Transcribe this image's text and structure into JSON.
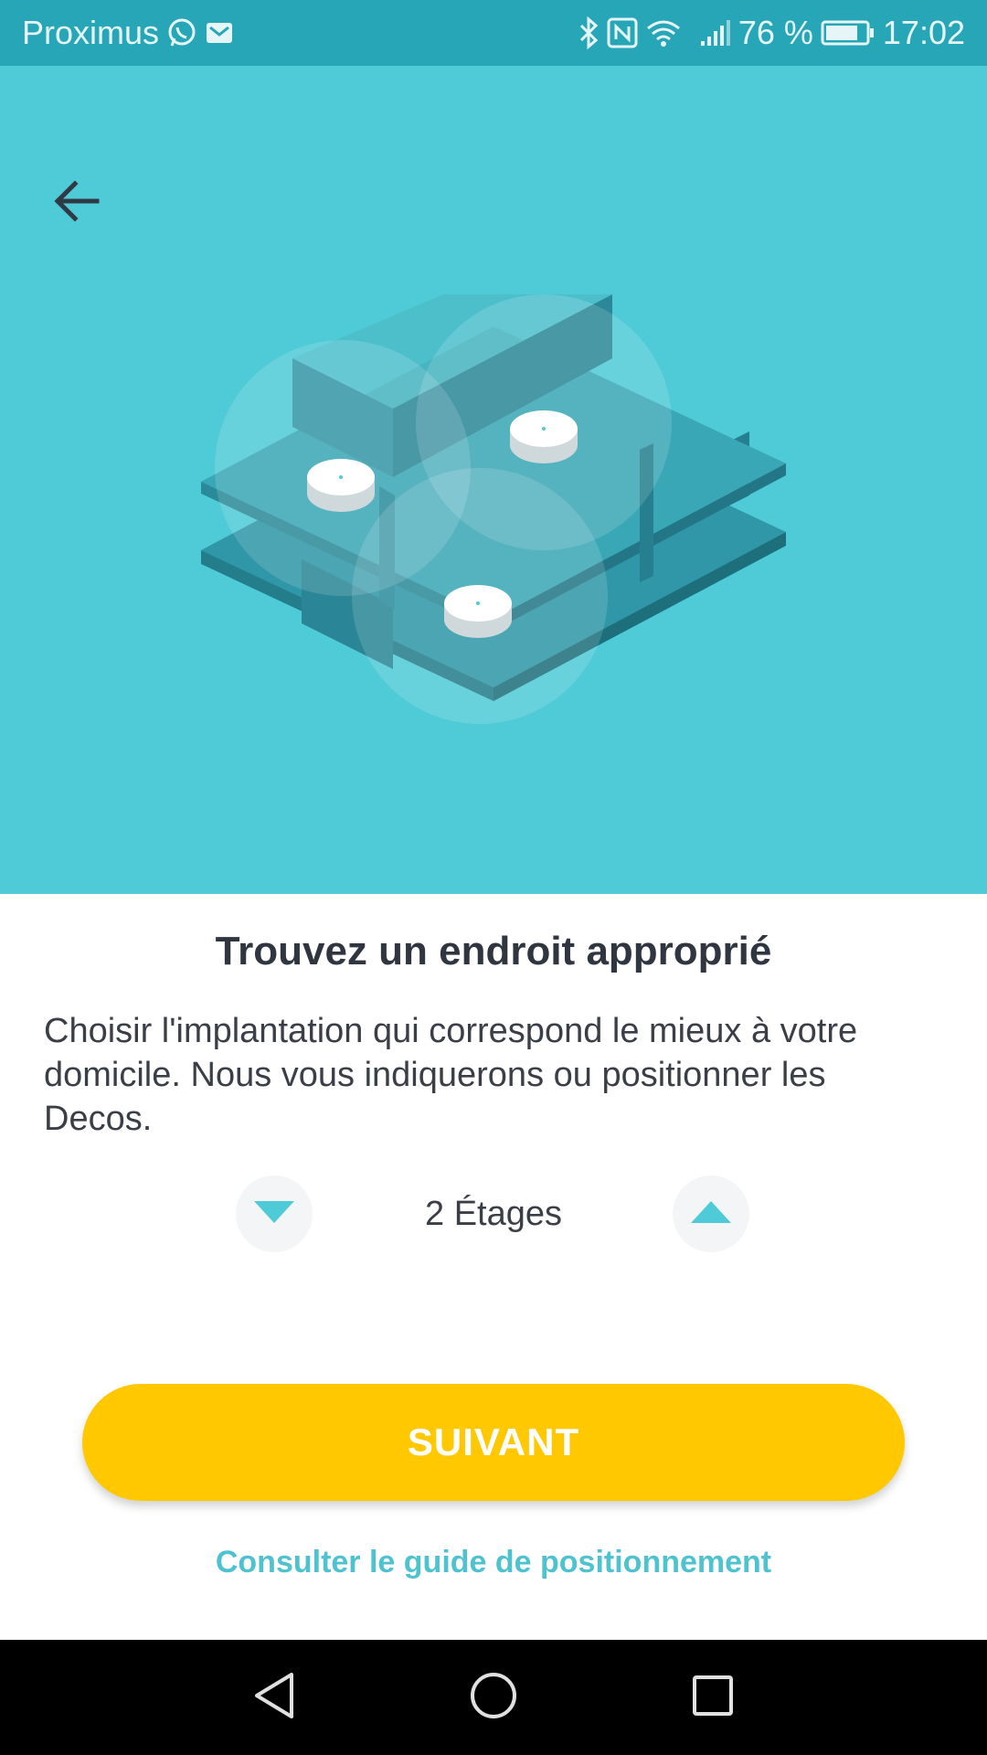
{
  "status_bar": {
    "carrier": "Proximus",
    "battery_percent": "76 %",
    "time": "17:02",
    "icons": [
      "whatsapp-icon",
      "mail-icon",
      "bluetooth-icon",
      "nfc-icon",
      "wifi-icon",
      "signal-icon",
      "battery-icon"
    ]
  },
  "hero": {
    "back_icon": "arrow-left-icon",
    "background_color": "#4ecbd7"
  },
  "content": {
    "title": "Trouvez un endroit approprié",
    "description": "Choisir l'implantation qui correspond le mieux à votre domicile. Nous vous indiquerons ou positionner les Decos.",
    "floors": {
      "value": "2 Étages",
      "decrease_icon": "triangle-down-icon",
      "increase_icon": "triangle-up-icon"
    },
    "next_button": "SUIVANT",
    "guide_link": "Consulter le guide de positionnement"
  },
  "colors": {
    "accent": "#4ecbd7",
    "button": "#ffc800",
    "link": "#4ec3cf"
  },
  "nav_bar": {
    "icons": [
      "nav-back-icon",
      "nav-home-icon",
      "nav-recents-icon"
    ]
  }
}
